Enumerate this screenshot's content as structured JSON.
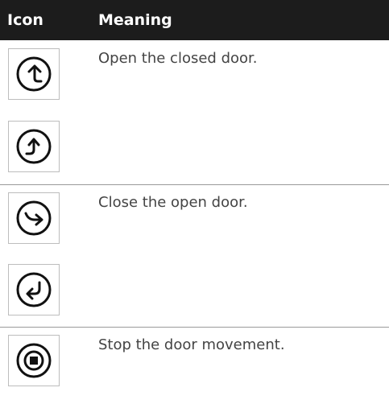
{
  "header": {
    "icon_label": "Icon",
    "meaning_label": "Meaning"
  },
  "rows": [
    {
      "meaning": "Open the closed door.",
      "icons": [
        "door-open-ccw-arrow-icon",
        "door-open-cw-arrow-icon"
      ]
    },
    {
      "meaning": "Close the open door.",
      "icons": [
        "door-close-down-right-arrow-icon",
        "door-close-down-left-arrow-icon"
      ]
    },
    {
      "meaning": "Stop the door movement.",
      "icons": [
        "door-stop-icon"
      ]
    }
  ]
}
